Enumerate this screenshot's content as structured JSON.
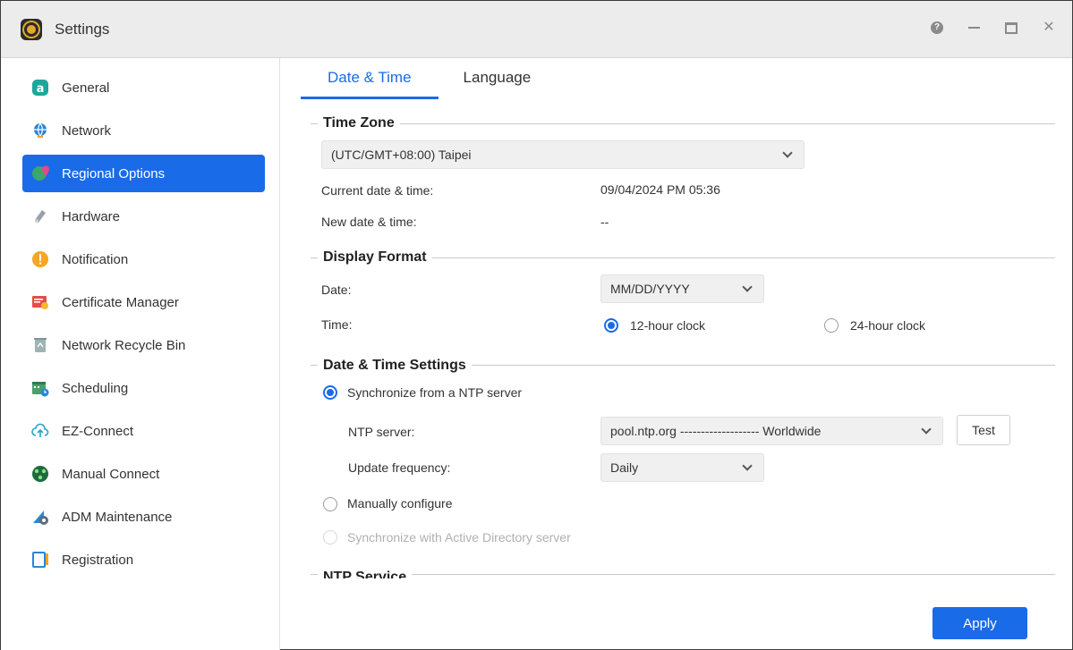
{
  "window": {
    "title": "Settings"
  },
  "sidebar": {
    "items": [
      {
        "label": "General",
        "icon": "general-icon"
      },
      {
        "label": "Network",
        "icon": "globe-icon"
      },
      {
        "label": "Regional Options",
        "icon": "regional-icon",
        "active": true
      },
      {
        "label": "Hardware",
        "icon": "hardware-icon"
      },
      {
        "label": "Notification",
        "icon": "notification-icon"
      },
      {
        "label": "Certificate Manager",
        "icon": "certificate-icon"
      },
      {
        "label": "Network Recycle Bin",
        "icon": "recycle-bin-icon"
      },
      {
        "label": "Scheduling",
        "icon": "calendar-icon"
      },
      {
        "label": "EZ-Connect",
        "icon": "cloud-upload-icon"
      },
      {
        "label": "Manual Connect",
        "icon": "manual-connect-icon"
      },
      {
        "label": "ADM Maintenance",
        "icon": "maintenance-icon"
      },
      {
        "label": "Registration",
        "icon": "registration-icon"
      }
    ]
  },
  "tabs": [
    {
      "label": "Date & Time",
      "active": true
    },
    {
      "label": "Language",
      "active": false
    }
  ],
  "timezone": {
    "section_title": "Time Zone",
    "selected": "(UTC/GMT+08:00) Taipei",
    "current_label": "Current date & time:",
    "current_value": "09/04/2024 PM 05:36",
    "new_label": "New date & time:",
    "new_value": "--"
  },
  "display_format": {
    "section_title": "Display Format",
    "date_label": "Date:",
    "date_selected": "MM/DD/YYYY",
    "time_label": "Time:",
    "time_12": "12-hour clock",
    "time_24": "24-hour clock"
  },
  "datetime_settings": {
    "section_title": "Date & Time Settings",
    "sync_ntp": "Synchronize from a NTP server",
    "ntp_server_label": "NTP server:",
    "ntp_server_selected": "pool.ntp.org ------------------- Worldwide",
    "test_label": "Test",
    "update_freq_label": "Update frequency:",
    "update_freq_selected": "Daily",
    "manual": "Manually configure",
    "sync_ad": "Synchronize with Active Directory server"
  },
  "ntp_service": {
    "section_title": "NTP Service"
  },
  "footer": {
    "apply_label": "Apply"
  },
  "colors": {
    "accent": "#1a6be8"
  }
}
